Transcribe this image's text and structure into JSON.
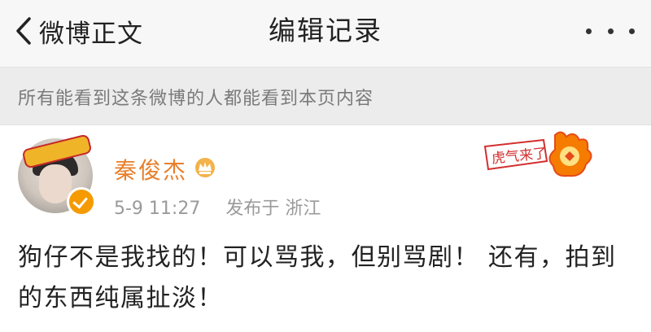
{
  "header": {
    "back_label": "微博正文",
    "title": "编辑记录"
  },
  "notice": {
    "text": "所有能看到这条微博的人都能看到本页内容"
  },
  "post": {
    "author": "秦俊杰",
    "time": "5-9 11:27",
    "source": "发布于 浙江",
    "text": "狗仔不是我找的！可以骂我，但别骂剧！ 还有，拍到的东西纯属扯淡！"
  },
  "decoration": {
    "sticker_text": "虎气来了"
  },
  "icons": {
    "back": "chevron-left-icon",
    "more": "more-dots-icon",
    "verified": "verified-badge-icon",
    "member": "member-crown-icon"
  },
  "colors": {
    "accent": "#e87f2b",
    "notice_bg": "#ececec",
    "verified": "#f59a00"
  }
}
